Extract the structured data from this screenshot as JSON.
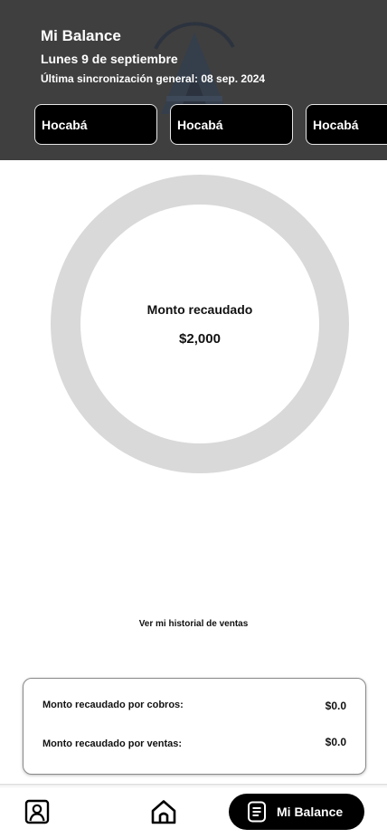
{
  "header": {
    "title": "Mi Balance",
    "date": "Lunes 9 de septiembre",
    "sync": "Última sincronización general: 08 sep. 2024"
  },
  "stores": [
    {
      "label": "Hocabá"
    },
    {
      "label": "Hocabá"
    },
    {
      "label": "Hocabá"
    }
  ],
  "donut": {
    "label": "Monto recaudado",
    "value": "$2,000"
  },
  "history_link": "Ver mi historial de ventas",
  "summary": {
    "rows": [
      {
        "label": "Monto recaudado por cobros:",
        "value": "$0.0"
      },
      {
        "label": "Monto recaudado por ventas:",
        "value": "$0.0"
      }
    ]
  },
  "bottom_nav": {
    "items": [
      {
        "icon": "profile-icon"
      },
      {
        "icon": "home-icon"
      },
      {
        "icon": "document-icon",
        "label": "Mi Balance",
        "active": true
      }
    ]
  }
}
